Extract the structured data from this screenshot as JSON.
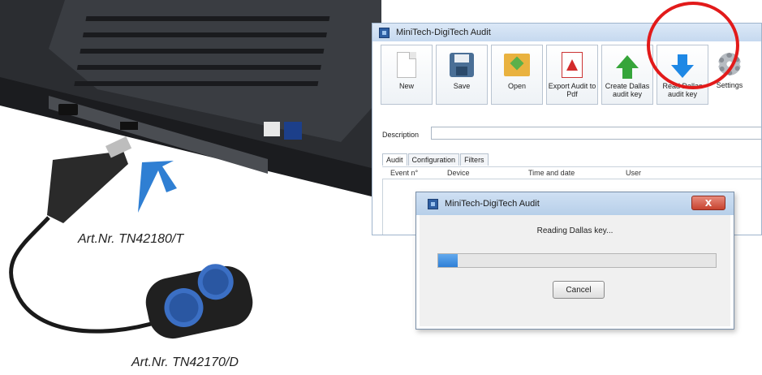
{
  "captions": {
    "usb_adapter": "Art.Nr. TN42180/T",
    "key_reader": "Art.Nr. TN42170/D"
  },
  "app": {
    "title": "MiniTech-DigiTech Audit",
    "toolbar": [
      {
        "label": "New",
        "icon": "new-file-icon"
      },
      {
        "label": "Save",
        "icon": "save-icon"
      },
      {
        "label": "Open",
        "icon": "open-folder-icon"
      },
      {
        "label": "Export Audit to Pdf",
        "icon": "pdf-icon"
      },
      {
        "label": "Create Dallas audit key",
        "icon": "up-arrow-icon"
      },
      {
        "label": "Read Dallas audit key",
        "icon": "down-arrow-icon"
      },
      {
        "label": "Settings",
        "icon": "gear-icon"
      }
    ],
    "description_label": "Description",
    "description_value": "",
    "tabs": [
      "Audit",
      "Configuration",
      "Filters"
    ],
    "active_tab": "Audit",
    "table_columns": [
      "Event n°",
      "Device",
      "Time and date",
      "User"
    ],
    "highlight_color": "#e21a1a"
  },
  "dialog": {
    "title": "MiniTech-DigiTech Audit",
    "close_label": "X",
    "message": "Reading Dallas key...",
    "progress": 0.07,
    "cancel_label": "Cancel"
  }
}
